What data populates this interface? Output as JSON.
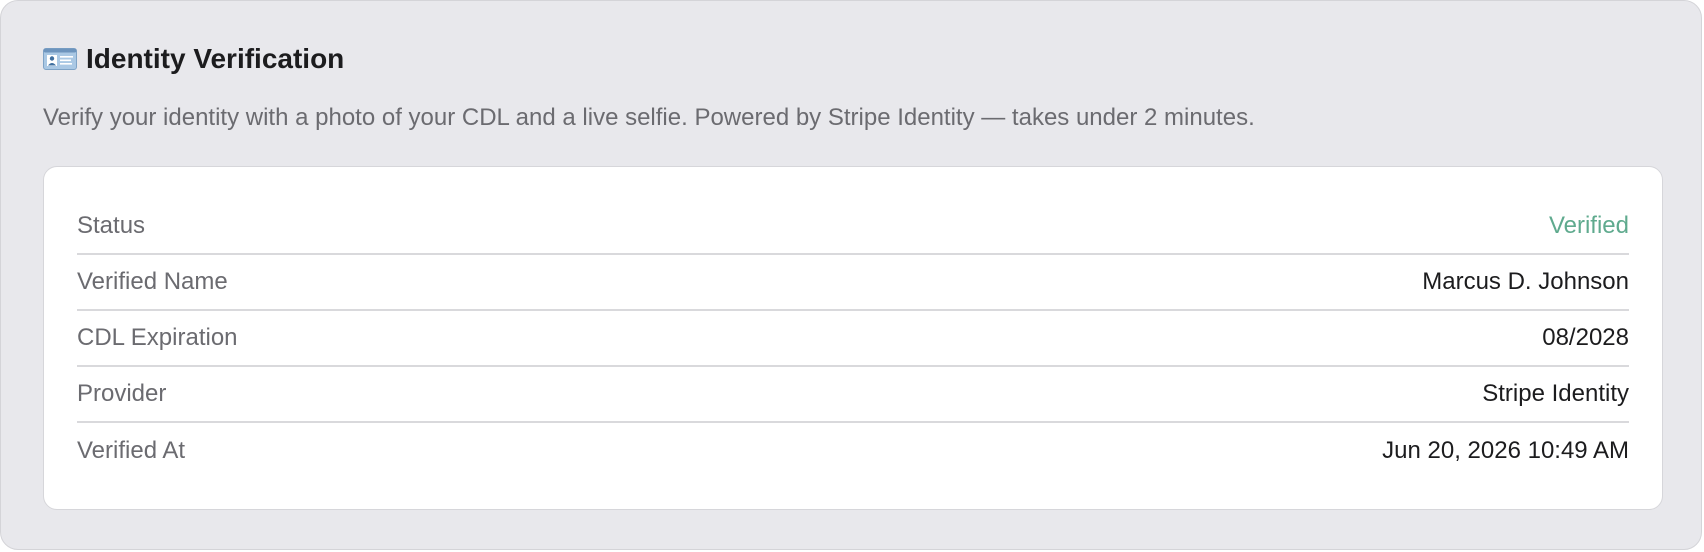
{
  "section": {
    "icon": "id-card-icon",
    "title": "Identity Verification",
    "description": "Verify your identity with a photo of your CDL and a live selfie. Powered by Stripe Identity — takes under 2 minutes."
  },
  "details": {
    "rows": [
      {
        "label": "Status",
        "value": "Verified"
      },
      {
        "label": "Verified Name",
        "value": "Marcus D. Johnson"
      },
      {
        "label": "CDL Expiration",
        "value": "08/2028"
      },
      {
        "label": "Provider",
        "value": "Stripe Identity"
      },
      {
        "label": "Verified At",
        "value": "Jun 20, 2026 10:49 AM"
      }
    ]
  },
  "colors": {
    "status_verified": "#5faa8e",
    "card_background": "#e8e8ec",
    "text_primary": "#1c1c1e",
    "text_secondary": "#6b6b70"
  }
}
